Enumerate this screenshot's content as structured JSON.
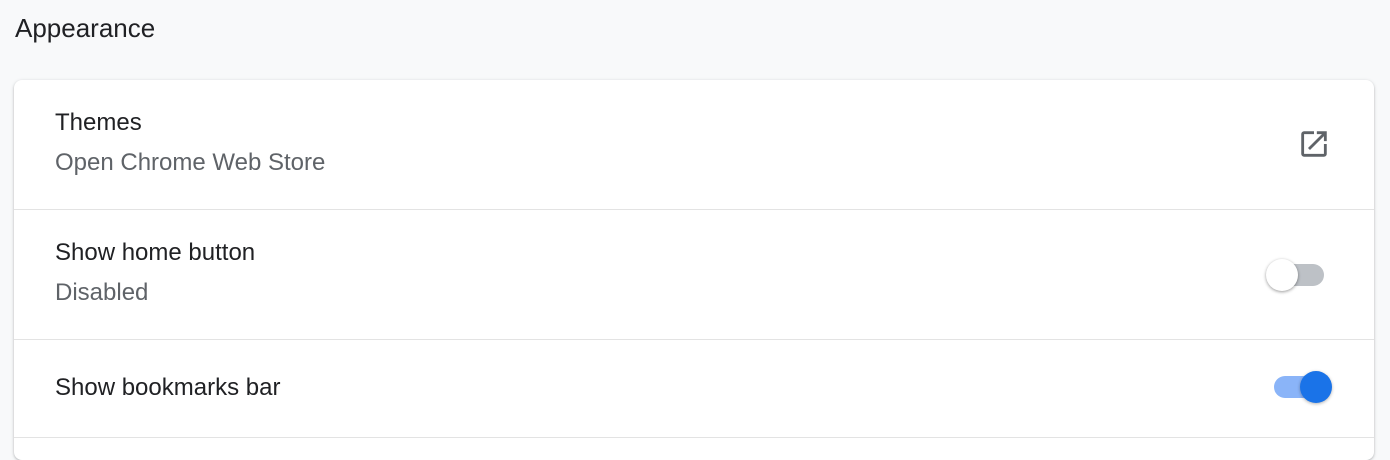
{
  "section": {
    "title": "Appearance"
  },
  "themes": {
    "label": "Themes",
    "sublabel": "Open Chrome Web Store",
    "icon": "open-in-new-icon"
  },
  "home_button": {
    "label": "Show home button",
    "sublabel": "Disabled",
    "enabled": false
  },
  "bookmarks_bar": {
    "label": "Show bookmarks bar",
    "enabled": true
  },
  "colors": {
    "accent": "#1a73e8",
    "toggle_on_track": "#8ab4f8",
    "toggle_off_track": "#bdc1c6",
    "secondary_text": "#5f6368"
  }
}
